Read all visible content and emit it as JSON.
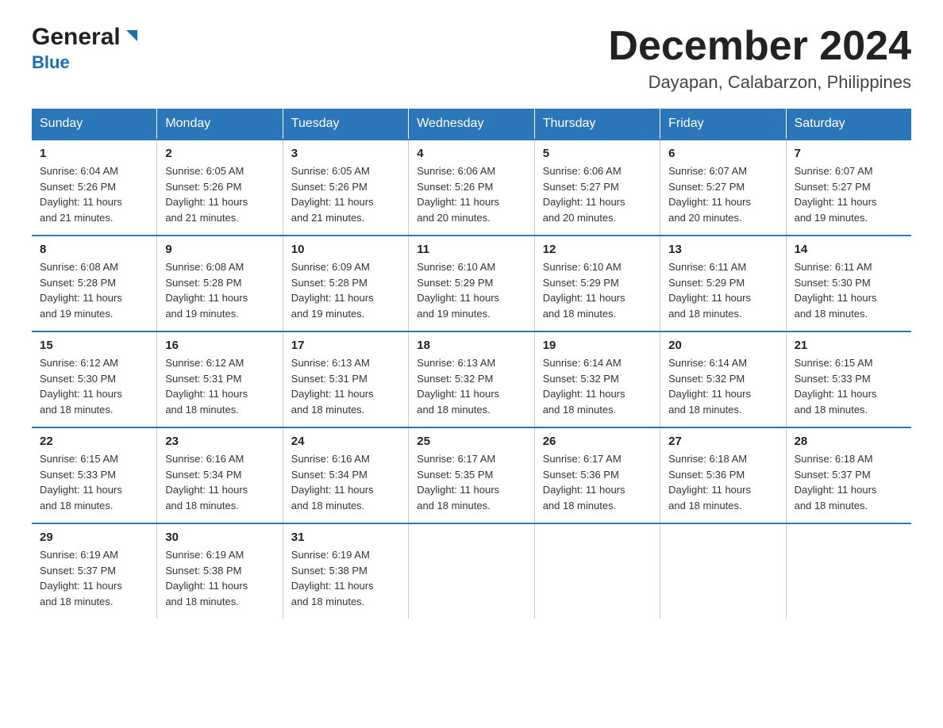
{
  "header": {
    "logo_general": "General",
    "logo_blue": "Blue",
    "title": "December 2024",
    "subtitle": "Dayapan, Calabarzon, Philippines"
  },
  "days_of_week": [
    "Sunday",
    "Monday",
    "Tuesday",
    "Wednesday",
    "Thursday",
    "Friday",
    "Saturday"
  ],
  "weeks": [
    [
      {
        "day": "1",
        "sunrise": "6:04 AM",
        "sunset": "5:26 PM",
        "daylight": "11 hours and 21 minutes."
      },
      {
        "day": "2",
        "sunrise": "6:05 AM",
        "sunset": "5:26 PM",
        "daylight": "11 hours and 21 minutes."
      },
      {
        "day": "3",
        "sunrise": "6:05 AM",
        "sunset": "5:26 PM",
        "daylight": "11 hours and 21 minutes."
      },
      {
        "day": "4",
        "sunrise": "6:06 AM",
        "sunset": "5:26 PM",
        "daylight": "11 hours and 20 minutes."
      },
      {
        "day": "5",
        "sunrise": "6:06 AM",
        "sunset": "5:27 PM",
        "daylight": "11 hours and 20 minutes."
      },
      {
        "day": "6",
        "sunrise": "6:07 AM",
        "sunset": "5:27 PM",
        "daylight": "11 hours and 20 minutes."
      },
      {
        "day": "7",
        "sunrise": "6:07 AM",
        "sunset": "5:27 PM",
        "daylight": "11 hours and 19 minutes."
      }
    ],
    [
      {
        "day": "8",
        "sunrise": "6:08 AM",
        "sunset": "5:28 PM",
        "daylight": "11 hours and 19 minutes."
      },
      {
        "day": "9",
        "sunrise": "6:08 AM",
        "sunset": "5:28 PM",
        "daylight": "11 hours and 19 minutes."
      },
      {
        "day": "10",
        "sunrise": "6:09 AM",
        "sunset": "5:28 PM",
        "daylight": "11 hours and 19 minutes."
      },
      {
        "day": "11",
        "sunrise": "6:10 AM",
        "sunset": "5:29 PM",
        "daylight": "11 hours and 19 minutes."
      },
      {
        "day": "12",
        "sunrise": "6:10 AM",
        "sunset": "5:29 PM",
        "daylight": "11 hours and 18 minutes."
      },
      {
        "day": "13",
        "sunrise": "6:11 AM",
        "sunset": "5:29 PM",
        "daylight": "11 hours and 18 minutes."
      },
      {
        "day": "14",
        "sunrise": "6:11 AM",
        "sunset": "5:30 PM",
        "daylight": "11 hours and 18 minutes."
      }
    ],
    [
      {
        "day": "15",
        "sunrise": "6:12 AM",
        "sunset": "5:30 PM",
        "daylight": "11 hours and 18 minutes."
      },
      {
        "day": "16",
        "sunrise": "6:12 AM",
        "sunset": "5:31 PM",
        "daylight": "11 hours and 18 minutes."
      },
      {
        "day": "17",
        "sunrise": "6:13 AM",
        "sunset": "5:31 PM",
        "daylight": "11 hours and 18 minutes."
      },
      {
        "day": "18",
        "sunrise": "6:13 AM",
        "sunset": "5:32 PM",
        "daylight": "11 hours and 18 minutes."
      },
      {
        "day": "19",
        "sunrise": "6:14 AM",
        "sunset": "5:32 PM",
        "daylight": "11 hours and 18 minutes."
      },
      {
        "day": "20",
        "sunrise": "6:14 AM",
        "sunset": "5:32 PM",
        "daylight": "11 hours and 18 minutes."
      },
      {
        "day": "21",
        "sunrise": "6:15 AM",
        "sunset": "5:33 PM",
        "daylight": "11 hours and 18 minutes."
      }
    ],
    [
      {
        "day": "22",
        "sunrise": "6:15 AM",
        "sunset": "5:33 PM",
        "daylight": "11 hours and 18 minutes."
      },
      {
        "day": "23",
        "sunrise": "6:16 AM",
        "sunset": "5:34 PM",
        "daylight": "11 hours and 18 minutes."
      },
      {
        "day": "24",
        "sunrise": "6:16 AM",
        "sunset": "5:34 PM",
        "daylight": "11 hours and 18 minutes."
      },
      {
        "day": "25",
        "sunrise": "6:17 AM",
        "sunset": "5:35 PM",
        "daylight": "11 hours and 18 minutes."
      },
      {
        "day": "26",
        "sunrise": "6:17 AM",
        "sunset": "5:36 PM",
        "daylight": "11 hours and 18 minutes."
      },
      {
        "day": "27",
        "sunrise": "6:18 AM",
        "sunset": "5:36 PM",
        "daylight": "11 hours and 18 minutes."
      },
      {
        "day": "28",
        "sunrise": "6:18 AM",
        "sunset": "5:37 PM",
        "daylight": "11 hours and 18 minutes."
      }
    ],
    [
      {
        "day": "29",
        "sunrise": "6:19 AM",
        "sunset": "5:37 PM",
        "daylight": "11 hours and 18 minutes."
      },
      {
        "day": "30",
        "sunrise": "6:19 AM",
        "sunset": "5:38 PM",
        "daylight": "11 hours and 18 minutes."
      },
      {
        "day": "31",
        "sunrise": "6:19 AM",
        "sunset": "5:38 PM",
        "daylight": "11 hours and 18 minutes."
      },
      null,
      null,
      null,
      null
    ]
  ],
  "labels": {
    "sunrise": "Sunrise:",
    "sunset": "Sunset:",
    "daylight": "Daylight:"
  }
}
